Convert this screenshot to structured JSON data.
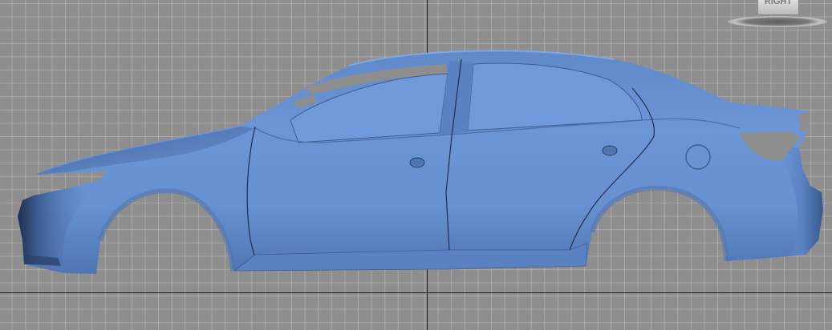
{
  "viewport": {
    "background": "#8e8e8e",
    "grid_color": "#bebebe",
    "axis_color": "#1e1e1e"
  },
  "viewcube": {
    "face_label": "RIGHT"
  },
  "model": {
    "color": "#6a93d3",
    "shadow_color": "#2a3f66"
  }
}
